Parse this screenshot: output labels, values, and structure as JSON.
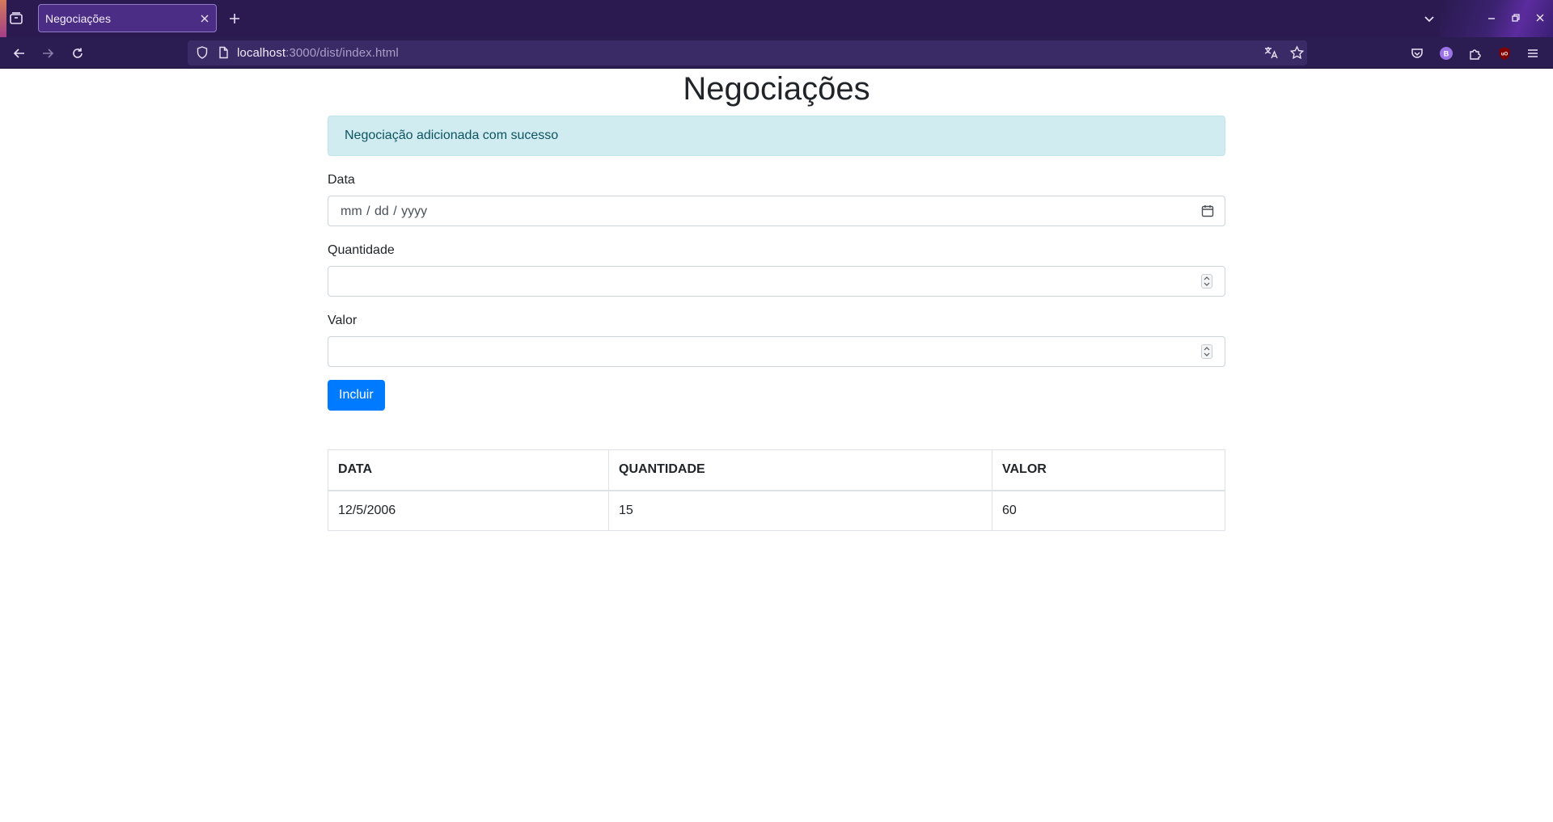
{
  "browser": {
    "tab_title": "Negociações",
    "url_host": "localhost",
    "url_rest": ":3000/dist/index.html",
    "accent": "#2a1a4f"
  },
  "page": {
    "heading": "Negociações",
    "alert_message": "Negociação adicionada com sucesso",
    "form": {
      "data_label": "Data",
      "data_placeholder": "mm / dd / yyyy",
      "quantidade_label": "Quantidade",
      "quantidade_value": "",
      "valor_label": "Valor",
      "valor_value": "",
      "submit_label": "Incluir"
    },
    "table": {
      "headers": [
        "DATA",
        "QUANTIDADE",
        "VALOR"
      ],
      "rows": [
        [
          "12/5/2006",
          "15",
          "60"
        ]
      ]
    },
    "colors": {
      "primary": "#007bff",
      "alert_bg": "#d1ecf1",
      "alert_text": "#0c5460"
    }
  }
}
